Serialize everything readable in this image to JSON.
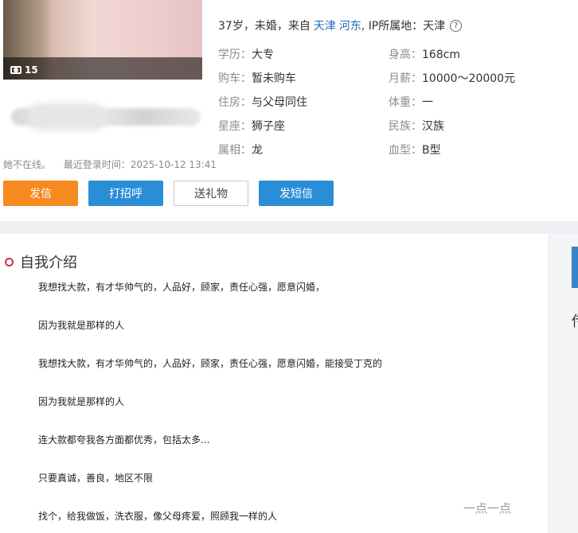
{
  "profile": {
    "photo_count": "15",
    "headline": {
      "prefix": "37岁，未婚，来自",
      "city": "天津",
      "district": "河东",
      "ip_text": ", IP所属地：天津",
      "help": "?"
    },
    "login_status": "她不在线。",
    "last_login": "最近登录时间：2025-10-12 13:41",
    "attributes": [
      {
        "key": "学历：",
        "value": "大专"
      },
      {
        "key": "身高：",
        "value": "168cm"
      },
      {
        "key": "购车：",
        "value": "暂未购车"
      },
      {
        "key": "月薪：",
        "value": "10000～20000元"
      },
      {
        "key": "住房：",
        "value": "与父母同住"
      },
      {
        "key": "体重：",
        "value": "一"
      },
      {
        "key": "星座：",
        "value": "狮子座"
      },
      {
        "key": "民族：",
        "value": "汉族"
      },
      {
        "key": "属相：",
        "value": "龙"
      },
      {
        "key": "血型：",
        "value": "B型"
      }
    ]
  },
  "actions": {
    "send_letter": "发信",
    "greet": "打招呼",
    "gift": "送礼物",
    "sms": "发短信"
  },
  "intro": {
    "title": "自我介绍",
    "paragraphs": [
      "我想找大款，有才华帅气的，人品好，顾家，责任心强，愿意闪婚，",
      "因为我就是那样的人",
      "我想找大款，有才华帅气的，人品好，顾家，责任心强，愿意闪婚，能接受丁克的",
      "因为我就是那样的人",
      "连大款都夸我各方面都优秀，包括太多...",
      "只要真诚，善良，地区不限",
      "找个，给我做饭，洗衣服，像父母疼爱，照顾我一样的人"
    ]
  },
  "sidebar": {
    "partial_char": "传"
  },
  "watermark": "一点一点",
  "colors": {
    "link": "#1e6fb5",
    "orange_button": "#f6891f",
    "blue_button": "#2a8ed6",
    "section_marker": "#c2354c"
  }
}
